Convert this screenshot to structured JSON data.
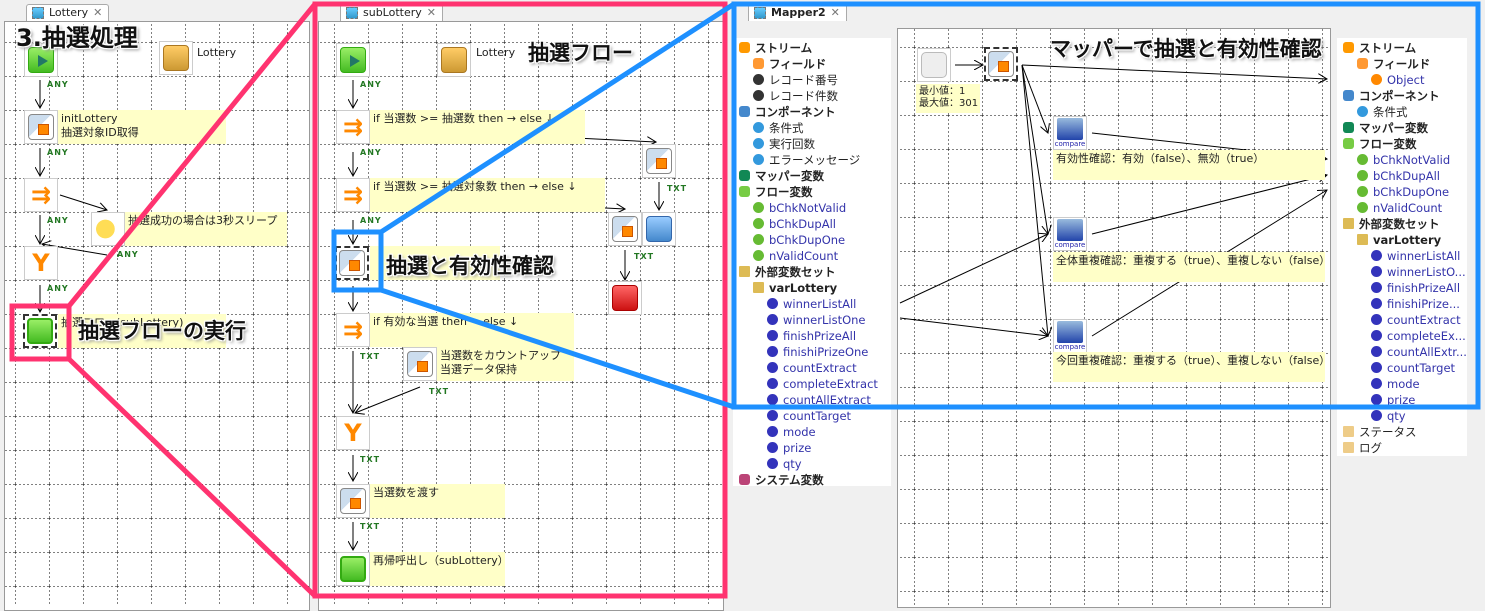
{
  "panel_lottery": {
    "tab": "Lottery",
    "heading": "3.抽選処理",
    "callout": "抽選フローの実行",
    "lottery_label": "Lottery",
    "notes": {
      "init_line1": "initLottery",
      "init_line2": "抽選対象ID取得",
      "sleep": "抽選成功の場合は3秒スリープ",
      "exec": "抽選フロー(subLottery)"
    },
    "link_label": "ANY"
  },
  "panel_sublottery": {
    "tab": "subLottery",
    "callout": "抽選フロー",
    "callout2": "抽選と有効性確認",
    "lottery_label": "Lottery",
    "notes": {
      "if1": "if 当選数 >= 抽選数 then → else ↓",
      "if2": "if 当選数 >= 抽選対象数 then → else ↓",
      "if3": "if 有効な当選 then → else ↓",
      "count_line1": "当選数をカウントアップ",
      "count_line2": "当選データ保持",
      "pass": "当選数を渡す",
      "recurse": "再帰呼出し（subLottery）"
    },
    "link_any": "ANY",
    "link_txt": "TXT"
  },
  "panel_mapper": {
    "tab": "Mapper2",
    "callout": "マッパーで抽選と有効性確認",
    "dice_note_line1": "最小値：1",
    "dice_note_line2": "最大値：301",
    "compare_label": "compare",
    "notes": [
      "有効性確認：有効（false）、無効（true）",
      "全体重複確認：重複する（true）、重複しない（false）",
      "今回重複確認：重複する（true）、重複しない（false）"
    ],
    "left_tree": [
      {
        "label": "ストリーム",
        "icon": "stream-icon",
        "bold": true,
        "children": [
          {
            "label": "フィールド",
            "icon": "field-icon",
            "bold": true
          },
          {
            "label": "レコード番号",
            "icon": "black-dot"
          },
          {
            "label": "レコード件数",
            "icon": "black-dot"
          }
        ]
      },
      {
        "label": "コンポーネント",
        "icon": "component-icon",
        "bold": true,
        "children": [
          {
            "label": "条件式",
            "icon": "blue-dot"
          },
          {
            "label": "実行回数",
            "icon": "blue-dot"
          },
          {
            "label": "エラーメッセージ",
            "icon": "blue-dot"
          }
        ]
      },
      {
        "label": "マッパー変数",
        "icon": "mapper-var-icon",
        "bold": true
      },
      {
        "label": "フロー変数",
        "icon": "flow-var-icon",
        "bold": true,
        "children": [
          {
            "label": "bChkNotValid",
            "icon": "green-dot"
          },
          {
            "label": "bChkDupAll",
            "icon": "green-dot"
          },
          {
            "label": "bChkDupOne",
            "icon": "green-dot"
          },
          {
            "label": "nValidCount",
            "icon": "green-dot"
          }
        ]
      },
      {
        "label": "外部変数セット",
        "icon": "chest-icon",
        "bold": true,
        "children": [
          {
            "label": "varLottery",
            "icon": "chest-icon",
            "bold": true,
            "children": [
              {
                "label": "winnerListAll",
                "icon": "navy-dot"
              },
              {
                "label": "winnerListOne",
                "icon": "navy-dot"
              },
              {
                "label": "finishPrizeAll",
                "icon": "navy-dot"
              },
              {
                "label": "finishiPrizeOne",
                "icon": "navy-dot"
              },
              {
                "label": "countExtract",
                "icon": "navy-dot"
              },
              {
                "label": "completeExtract",
                "icon": "navy-dot"
              },
              {
                "label": "countAllExtract",
                "icon": "navy-dot"
              },
              {
                "label": "countTarget",
                "icon": "navy-dot"
              },
              {
                "label": "mode",
                "icon": "navy-dot"
              },
              {
                "label": "prize",
                "icon": "navy-dot"
              },
              {
                "label": "qty",
                "icon": "navy-dot"
              }
            ]
          }
        ]
      },
      {
        "label": "システム変数",
        "icon": "system-var-icon",
        "bold": true
      }
    ],
    "right_tree": [
      {
        "label": "ストリーム",
        "icon": "stream-icon",
        "bold": true,
        "children": [
          {
            "label": "フィールド",
            "icon": "field-icon",
            "bold": true,
            "children": [
              {
                "label": "Object",
                "icon": "orange-dot"
              }
            ]
          }
        ]
      },
      {
        "label": "コンポーネント",
        "icon": "component-icon",
        "bold": true,
        "children": [
          {
            "label": "条件式",
            "icon": "blue-dot"
          }
        ]
      },
      {
        "label": "マッパー変数",
        "icon": "mapper-var-icon",
        "bold": true
      },
      {
        "label": "フロー変数",
        "icon": "flow-var-icon",
        "bold": true,
        "children": [
          {
            "label": "bChkNotValid",
            "icon": "green-dot"
          },
          {
            "label": "bChkDupAll",
            "icon": "green-dot"
          },
          {
            "label": "bChkDupOne",
            "icon": "green-dot"
          },
          {
            "label": "nValidCount",
            "icon": "green-dot"
          }
        ]
      },
      {
        "label": "外部変数セット",
        "icon": "chest-icon",
        "bold": true,
        "children": [
          {
            "label": "varLottery",
            "icon": "chest-icon",
            "bold": true,
            "children": [
              {
                "label": "winnerListAll",
                "icon": "navy-dot"
              },
              {
                "label": "winnerListO...",
                "icon": "navy-dot"
              },
              {
                "label": "finishPrizeAll",
                "icon": "navy-dot"
              },
              {
                "label": "finishiPrize...",
                "icon": "navy-dot"
              },
              {
                "label": "countExtract",
                "icon": "navy-dot"
              },
              {
                "label": "completeEx...",
                "icon": "navy-dot"
              },
              {
                "label": "countAllExtr...",
                "icon": "navy-dot"
              },
              {
                "label": "countTarget",
                "icon": "navy-dot"
              },
              {
                "label": "mode",
                "icon": "navy-dot"
              },
              {
                "label": "prize",
                "icon": "navy-dot"
              },
              {
                "label": "qty",
                "icon": "navy-dot"
              }
            ]
          }
        ]
      },
      {
        "label": "ステータス",
        "icon": "clipboard-icon"
      },
      {
        "label": "ログ",
        "icon": "clipboard-icon"
      }
    ]
  },
  "colors": {
    "highlight_pink": "#ff3370",
    "highlight_blue": "#1e90ff",
    "note_bg": "#ffffc8",
    "link_label": "#227722"
  }
}
